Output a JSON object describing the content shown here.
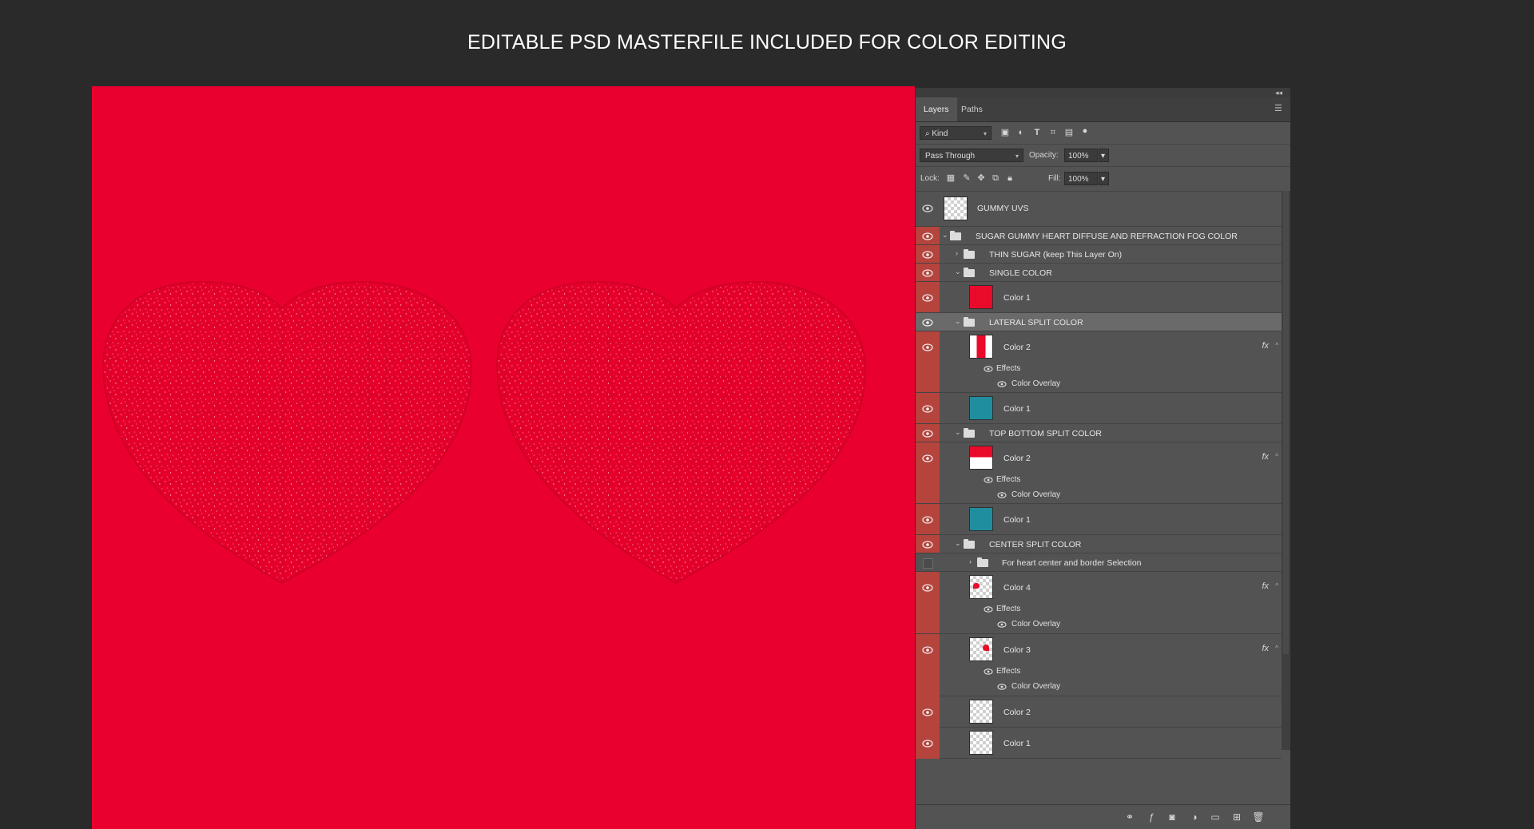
{
  "banner": {
    "title": "EDITABLE PSD MASTERFILE INCLUDED FOR COLOR EDITING"
  },
  "canvas": {
    "background": "#ea002e",
    "heart_color": "#e4002b"
  },
  "panel": {
    "tabs": [
      {
        "label": "Layers",
        "active": true
      },
      {
        "label": "Paths",
        "active": false
      }
    ],
    "filter_kind": "Kind",
    "blend_mode": "Pass Through",
    "opacity_label": "Opacity:",
    "opacity_value": "100%",
    "lock_label": "Lock:",
    "fill_label": "Fill:",
    "fill_value": "100%",
    "layers": {
      "gummy_uvs": "GUMMY UVS",
      "group_main": "SUGAR GUMMY HEART DIFFUSE AND REFRACTION FOG COLOR",
      "thin_sugar": "THIN SUGAR (keep This Layer On)",
      "single_color": "SINGLE COLOR",
      "single_color1": "Color 1",
      "lateral": "LATERAL SPLIT COLOR",
      "lateral_color2": "Color 2",
      "lateral_effects": "Effects",
      "lateral_overlay": "Color Overlay",
      "lateral_color1": "Color 1",
      "topbottom": "TOP BOTTOM SPLIT COLOR",
      "tb_color2": "Color 2",
      "tb_effects": "Effects",
      "tb_overlay": "Color Overlay",
      "tb_color1": "Color 1",
      "center": "CENTER SPLIT COLOR",
      "center_sel": "For heart center and border Selection",
      "center_color4": "Color 4",
      "c4_effects": "Effects",
      "c4_overlay": "Color Overlay",
      "center_color3": "Color 3",
      "c3_effects": "Effects",
      "c3_overlay": "Color Overlay",
      "center_color2": "Color 2",
      "center_color1": "Color 1"
    },
    "fx_label": "fx",
    "colors": {
      "red": "#ea0a2a",
      "teal": "#1f8e9e",
      "eye_strip": "#b5443d"
    }
  }
}
